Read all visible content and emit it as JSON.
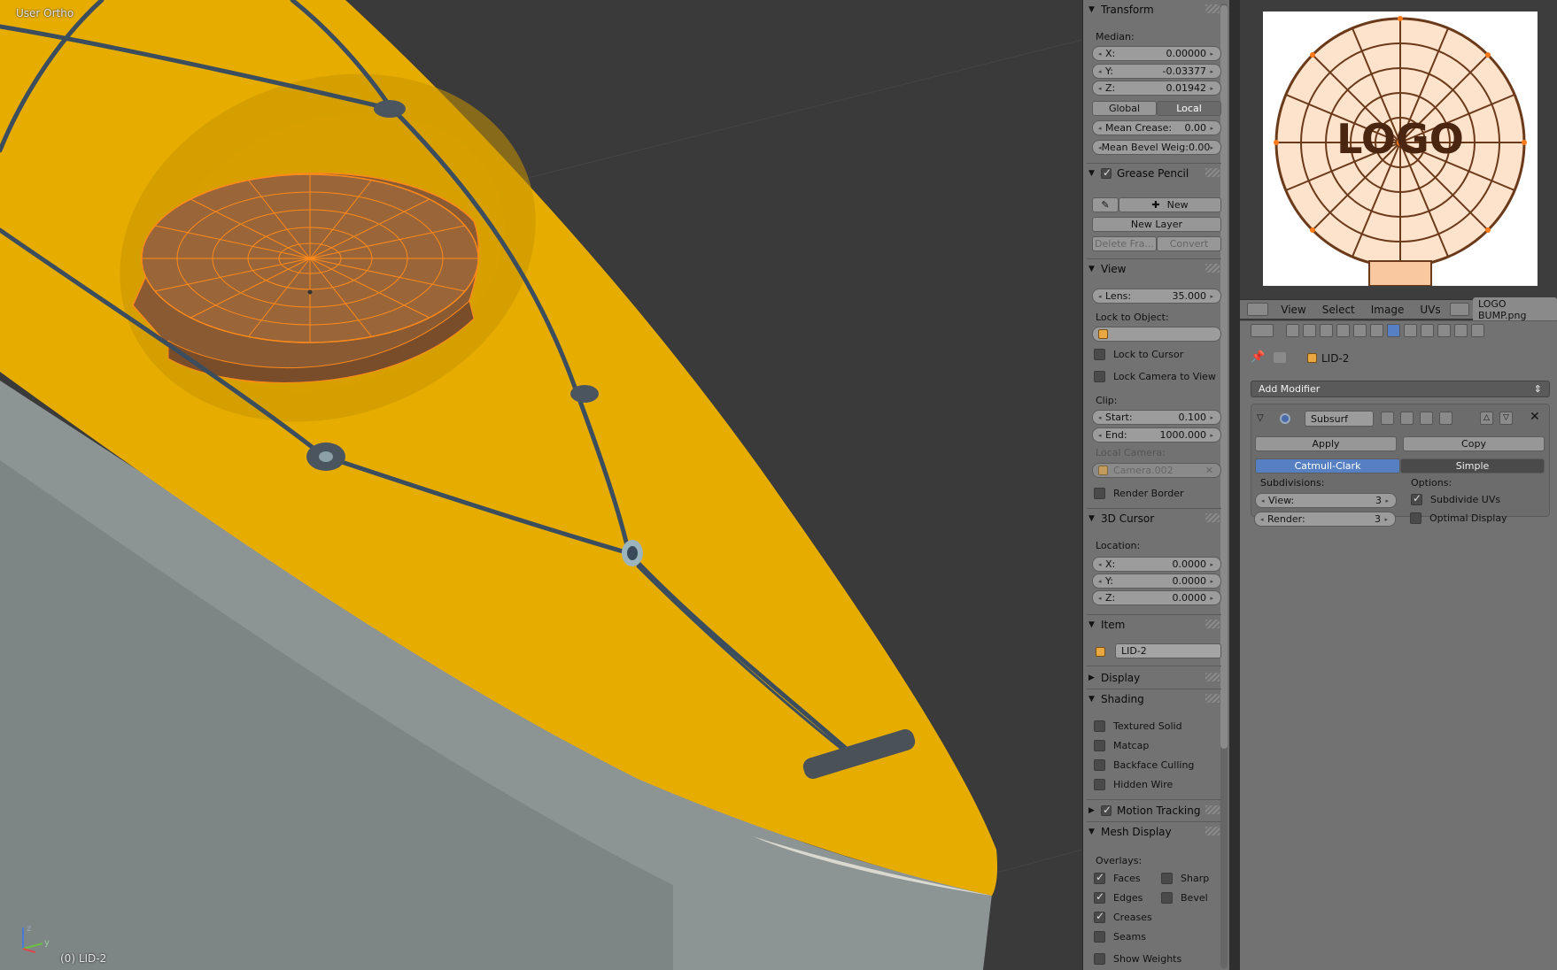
{
  "viewport": {
    "view_label": "User Ortho",
    "object_label": "(0) LID-2",
    "axis_y": "y",
    "axis_z": "z",
    "colors": {
      "background": "#3a3a3a",
      "hull_top": "#e6ad00",
      "hull_bottom": "#8d9494",
      "lid_fill": "#8a5a32",
      "wire": "#ff8a1a",
      "rope": "#3a4a5a"
    }
  },
  "npanel": {
    "transform": {
      "title": "Transform",
      "median_label": "Median:",
      "x_label": "X:",
      "x_value": "0.00000",
      "y_label": "Y:",
      "y_value": "-0.03377",
      "z_label": "Z:",
      "z_value": "0.01942",
      "global_label": "Global",
      "local_label": "Local",
      "crease_label": "Mean Crease:",
      "crease_value": "0.00",
      "bevel_label": "Mean Bevel Weig:",
      "bevel_value": "0.00"
    },
    "grease_pencil": {
      "title": "Grease Pencil",
      "new_label": "New",
      "new_layer_label": "New Layer",
      "delete_frame_label": "Delete Fra...",
      "convert_label": "Convert"
    },
    "view": {
      "title": "View",
      "lens_label": "Lens:",
      "lens_value": "35.000",
      "lock_object_label": "Lock to Object:",
      "lock_cursor_label": "Lock to Cursor",
      "lock_camera_label": "Lock Camera to View",
      "clip_label": "Clip:",
      "start_label": "Start:",
      "start_value": "0.100",
      "end_label": "End:",
      "end_value": "1000.000",
      "local_camera_label": "Local Camera:",
      "camera_value": "Camera.002",
      "render_border_label": "Render Border"
    },
    "cursor": {
      "title": "3D Cursor",
      "location_label": "Location:",
      "x_label": "X:",
      "x_value": "0.0000",
      "y_label": "Y:",
      "y_value": "0.0000",
      "z_label": "Z:",
      "z_value": "0.0000"
    },
    "item": {
      "title": "Item",
      "name_value": "LID-2"
    },
    "display": {
      "title": "Display"
    },
    "shading": {
      "title": "Shading",
      "textured_solid": "Textured Solid",
      "matcap": "Matcap",
      "backface_culling": "Backface Culling",
      "hidden_wire": "Hidden Wire"
    },
    "motion_tracking": {
      "title": "Motion Tracking"
    },
    "mesh_display": {
      "title": "Mesh Display",
      "overlays_label": "Overlays:",
      "faces": "Faces",
      "sharp": "Sharp",
      "edges": "Edges",
      "bevel": "Bevel",
      "creases": "Creases",
      "seams": "Seams",
      "show_weights": "Show Weights"
    }
  },
  "uv_editor": {
    "image_text": "LOGO",
    "menu_view": "View",
    "menu_select": "Select",
    "menu_image": "Image",
    "menu_uvs": "UVs",
    "image_name": "LOGO BUMP.png"
  },
  "properties": {
    "object_name": "LID-2",
    "add_modifier_label": "Add Modifier",
    "modifier_name": "Subsurf",
    "apply_label": "Apply",
    "copy_label": "Copy",
    "catmull_label": "Catmull-Clark",
    "simple_label": "Simple",
    "subdivisions_label": "Subdivisions:",
    "options_label": "Options:",
    "view_label": "View:",
    "view_value": "3",
    "render_label": "Render:",
    "render_value": "3",
    "subdivide_uvs_label": "Subdivide UVs",
    "optimal_display_label": "Optimal Display"
  }
}
